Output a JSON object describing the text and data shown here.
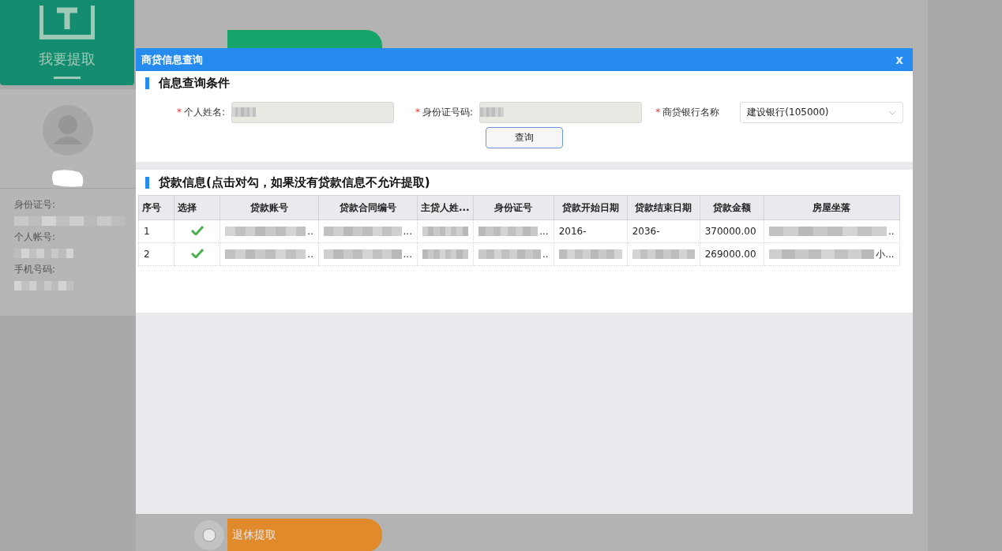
{
  "sidebar": {
    "card": {
      "label": "我要提取"
    },
    "profile_fields": [
      {
        "label": "身份证号:"
      },
      {
        "label": "个人帐号:"
      },
      {
        "label": "手机号码:"
      }
    ]
  },
  "options": [
    {
      "color": "#15a46a"
    },
    {
      "label": "退休提取",
      "color": "#e08a2c",
      "selected": false
    }
  ],
  "dialog": {
    "title": "商贷信息查询",
    "close": "x",
    "query_section": {
      "title": "信息查询条件",
      "fields": [
        {
          "marker": "*",
          "label": "个人姓名:",
          "kind": "text"
        },
        {
          "marker": "*",
          "label": "身份证号码:",
          "kind": "text"
        },
        {
          "marker": "*",
          "label": "商贷银行名称",
          "kind": "select",
          "value": "建设银行(105000)"
        }
      ],
      "button": "查询"
    },
    "loan_section": {
      "title": "贷款信息(点击对勾，如果没有贷款信息不允许提取)",
      "columns": [
        "序号",
        "选择",
        "贷款账号",
        "贷款合同编号",
        "主贷人姓...",
        "身份证号",
        "贷款开始日期",
        "贷款结束日期",
        "贷款金额",
        "房屋坐落"
      ],
      "rows": [
        {
          "cells": [
            {
              "kind": "text",
              "text": "1"
            },
            {
              "kind": "check",
              "checked": true
            },
            {
              "kind": "redacted",
              "text": ".."
            },
            {
              "kind": "redacted",
              "text": "..."
            },
            {
              "kind": "redacted"
            },
            {
              "kind": "redacted",
              "text": "..."
            },
            {
              "kind": "text",
              "text": "2016-"
            },
            {
              "kind": "text",
              "text": "2036-"
            },
            {
              "kind": "text",
              "text": "370000.00"
            },
            {
              "kind": "redacted",
              "text": ".."
            }
          ]
        },
        {
          "cells": [
            {
              "kind": "text",
              "text": "2"
            },
            {
              "kind": "check",
              "checked": true
            },
            {
              "kind": "redacted",
              "text": ".."
            },
            {
              "kind": "redacted",
              "text": "..."
            },
            {
              "kind": "redacted"
            },
            {
              "kind": "redacted",
              "text": ".."
            },
            {
              "kind": "redacted"
            },
            {
              "kind": "redacted"
            },
            {
              "kind": "text",
              "text": "269000.00"
            },
            {
              "kind": "redacted",
              "text": "小..."
            }
          ]
        }
      ]
    }
  }
}
